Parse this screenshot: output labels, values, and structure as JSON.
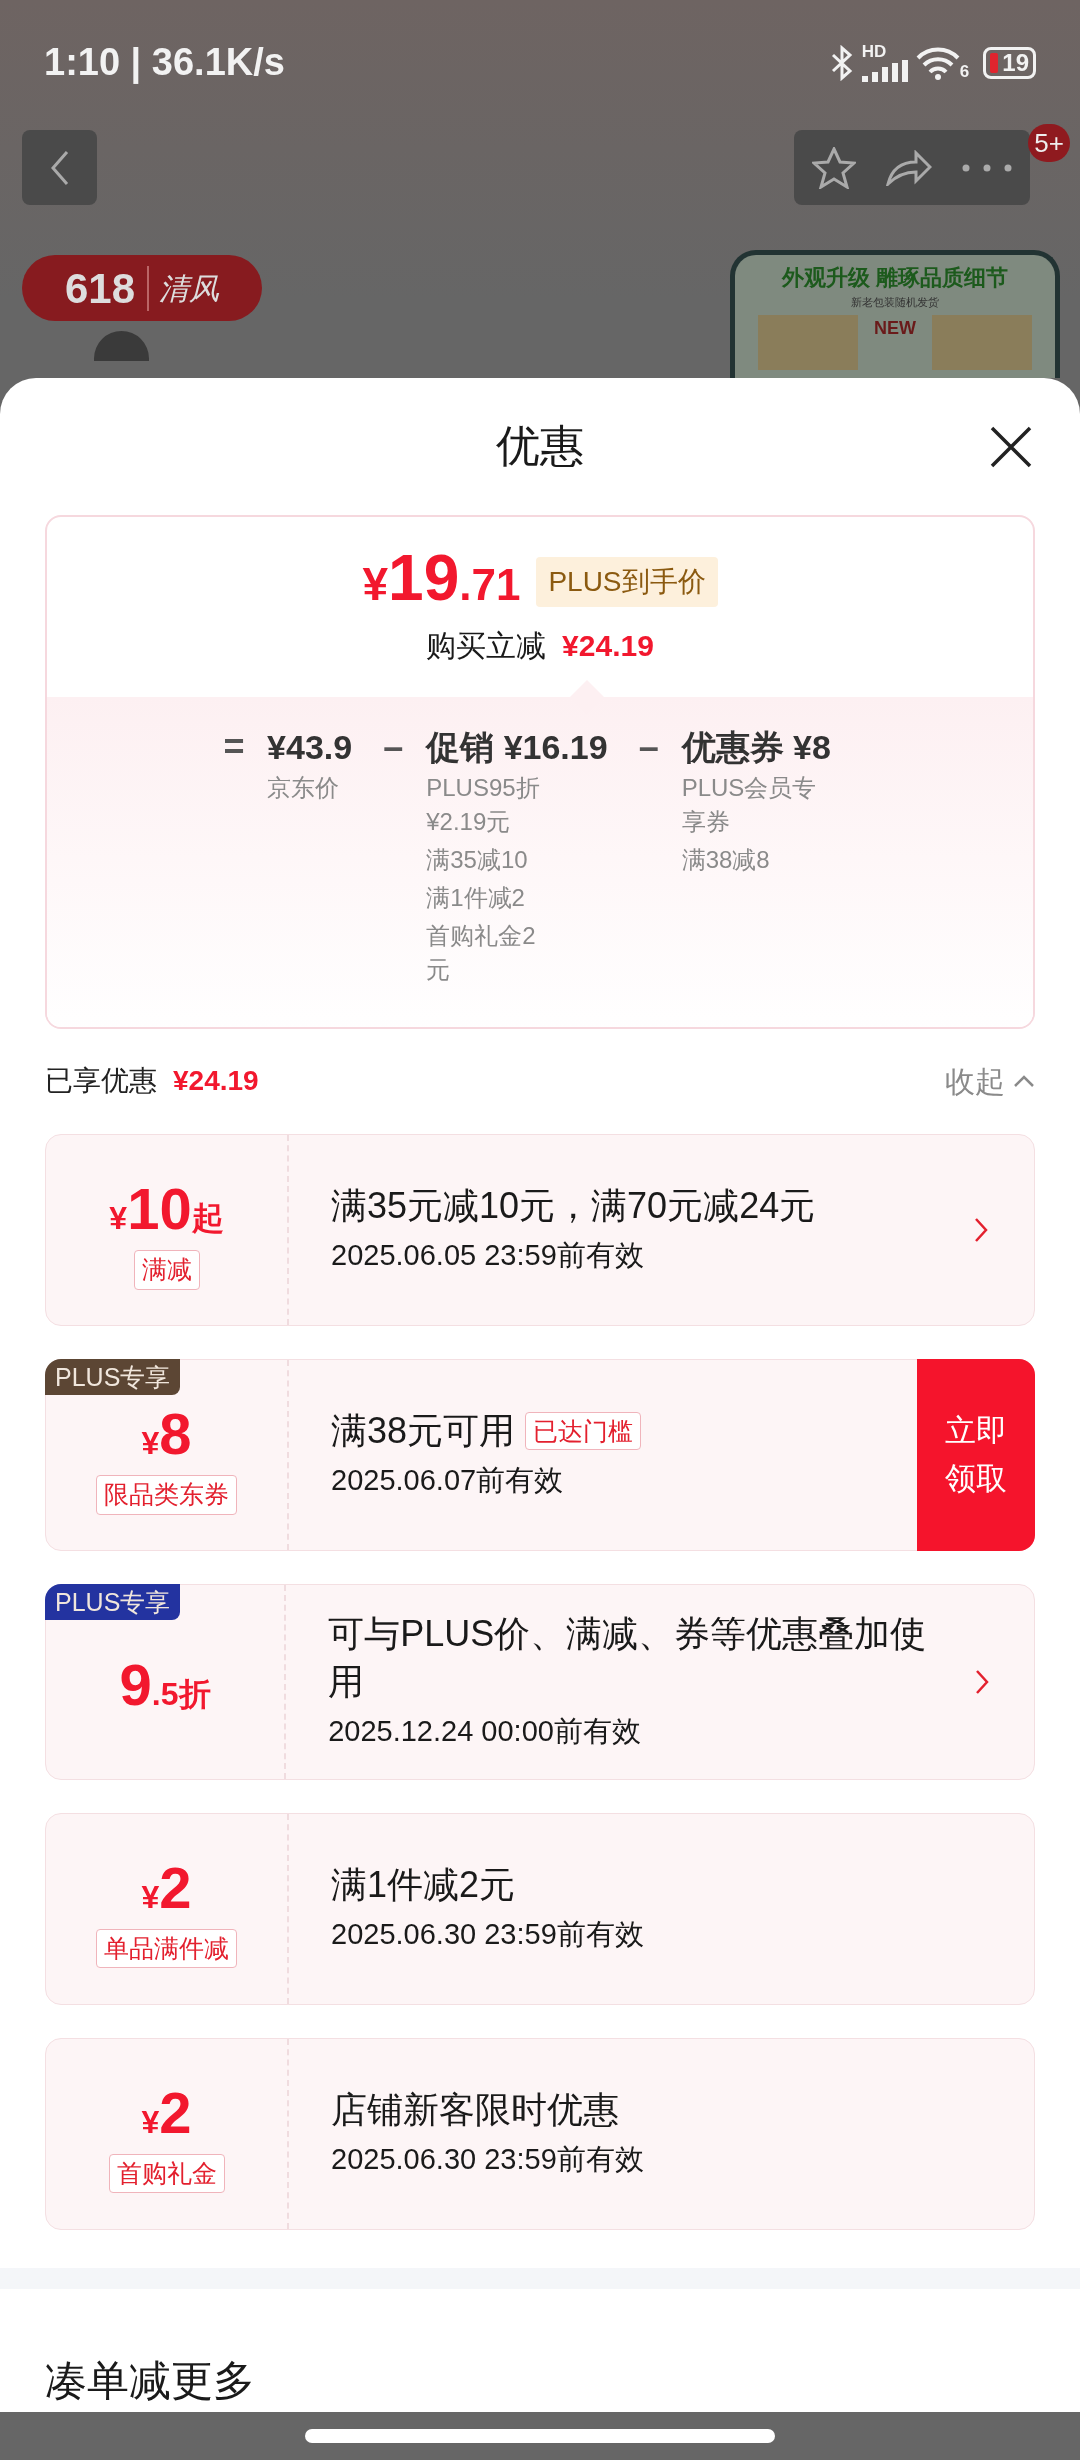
{
  "status_bar": {
    "time": "1:10 | 36.1K/s",
    "network": "HD",
    "wifi": "6",
    "battery": "19"
  },
  "app_bar": {
    "badge": "5+"
  },
  "product": {
    "brand_badge": {
      "number": "618",
      "logo": "清风"
    },
    "banner": {
      "headline": "外观升级 雕琢品质细节",
      "subline": "新老包装随机发货",
      "tag": "NEW"
    }
  },
  "sheet": {
    "title": "优惠",
    "price": {
      "currency": "¥",
      "integer": "19",
      "decimal": ".71",
      "label": "PLUS到手价",
      "saving_label": "购买立减",
      "saving": "¥24.19"
    },
    "breakdown": [
      {
        "operator": "=",
        "heading": "¥43.9",
        "notes": [
          "京东价"
        ]
      },
      {
        "operator": "–",
        "heading": "促销 ¥16.19",
        "notes": [
          "PLUS95折¥2.19元",
          "满35减10",
          "满1件减2",
          "首购礼金2元"
        ]
      },
      {
        "operator": "–",
        "heading": "优惠券 ¥8",
        "notes": [
          "PLUS会员专享券",
          "满38减8"
        ]
      }
    ],
    "enjoyed": {
      "label": "已享优惠",
      "amount": "¥24.19"
    },
    "collapse": "收起",
    "coupons": [
      {
        "currency": "¥",
        "amount": "10",
        "suffix": "起",
        "tag": "满减",
        "title": "满35元减10元，满70元减24元",
        "expiry": "2025.06.05 23:59前有效",
        "action": {
          "kind": "arrow"
        }
      },
      {
        "badge": {
          "text": "PLUS专享",
          "color": "#5c4634"
        },
        "currency": "¥",
        "amount": "8",
        "tag": "限品类东券",
        "title": "满38元可用",
        "status": "已达门槛",
        "expiry": "2025.06.07前有效",
        "action": {
          "kind": "button",
          "label": "立即领取"
        }
      },
      {
        "badge": {
          "text": "PLUS专享",
          "color": "#2333a0"
        },
        "amount": "9",
        "suffix": ".5折",
        "title": "可与PLUS价、满减、券等优惠叠加使用",
        "expiry": "2025.12.24 00:00前有效",
        "action": {
          "kind": "arrow"
        }
      },
      {
        "currency": "¥",
        "amount": "2",
        "tag": "单品满件减",
        "title": "满1件减2元",
        "expiry": "2025.06.30 23:59前有效"
      },
      {
        "currency": "¥",
        "amount": "2",
        "tag": "首购礼金",
        "title": "店铺新客限时优惠",
        "expiry": "2025.06.30 23:59前有效"
      }
    ],
    "section_title": "凑单减更多"
  }
}
